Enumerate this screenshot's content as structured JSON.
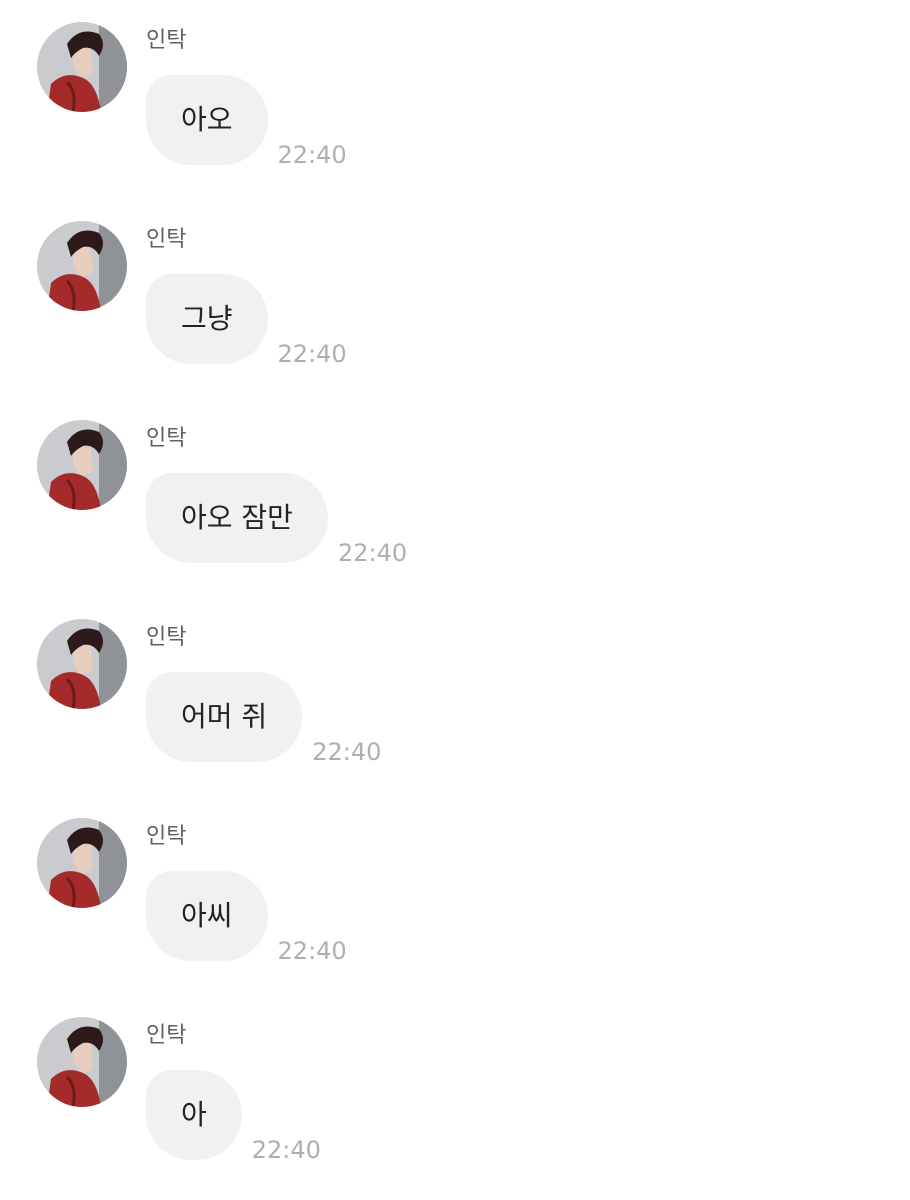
{
  "messages": [
    {
      "sender": "인탁",
      "text": "아오",
      "time": "22:40"
    },
    {
      "sender": "인탁",
      "text": "그냥",
      "time": "22:40"
    },
    {
      "sender": "인탁",
      "text": "아오 잠만",
      "time": "22:40"
    },
    {
      "sender": "인탁",
      "text": "어머 쥐",
      "time": "22:40"
    },
    {
      "sender": "인탁",
      "text": "아씨",
      "time": "22:40"
    },
    {
      "sender": "인탁",
      "text": "아",
      "time": "22:40"
    }
  ],
  "colors": {
    "bubble": "#f1f1f3",
    "message_text": "#222326",
    "sender_name": "#5f6063",
    "timestamp": "#aeafb3",
    "avatar_jacket": "#a52b2b"
  },
  "icons": {
    "avatar": "profile-photo-icon"
  }
}
